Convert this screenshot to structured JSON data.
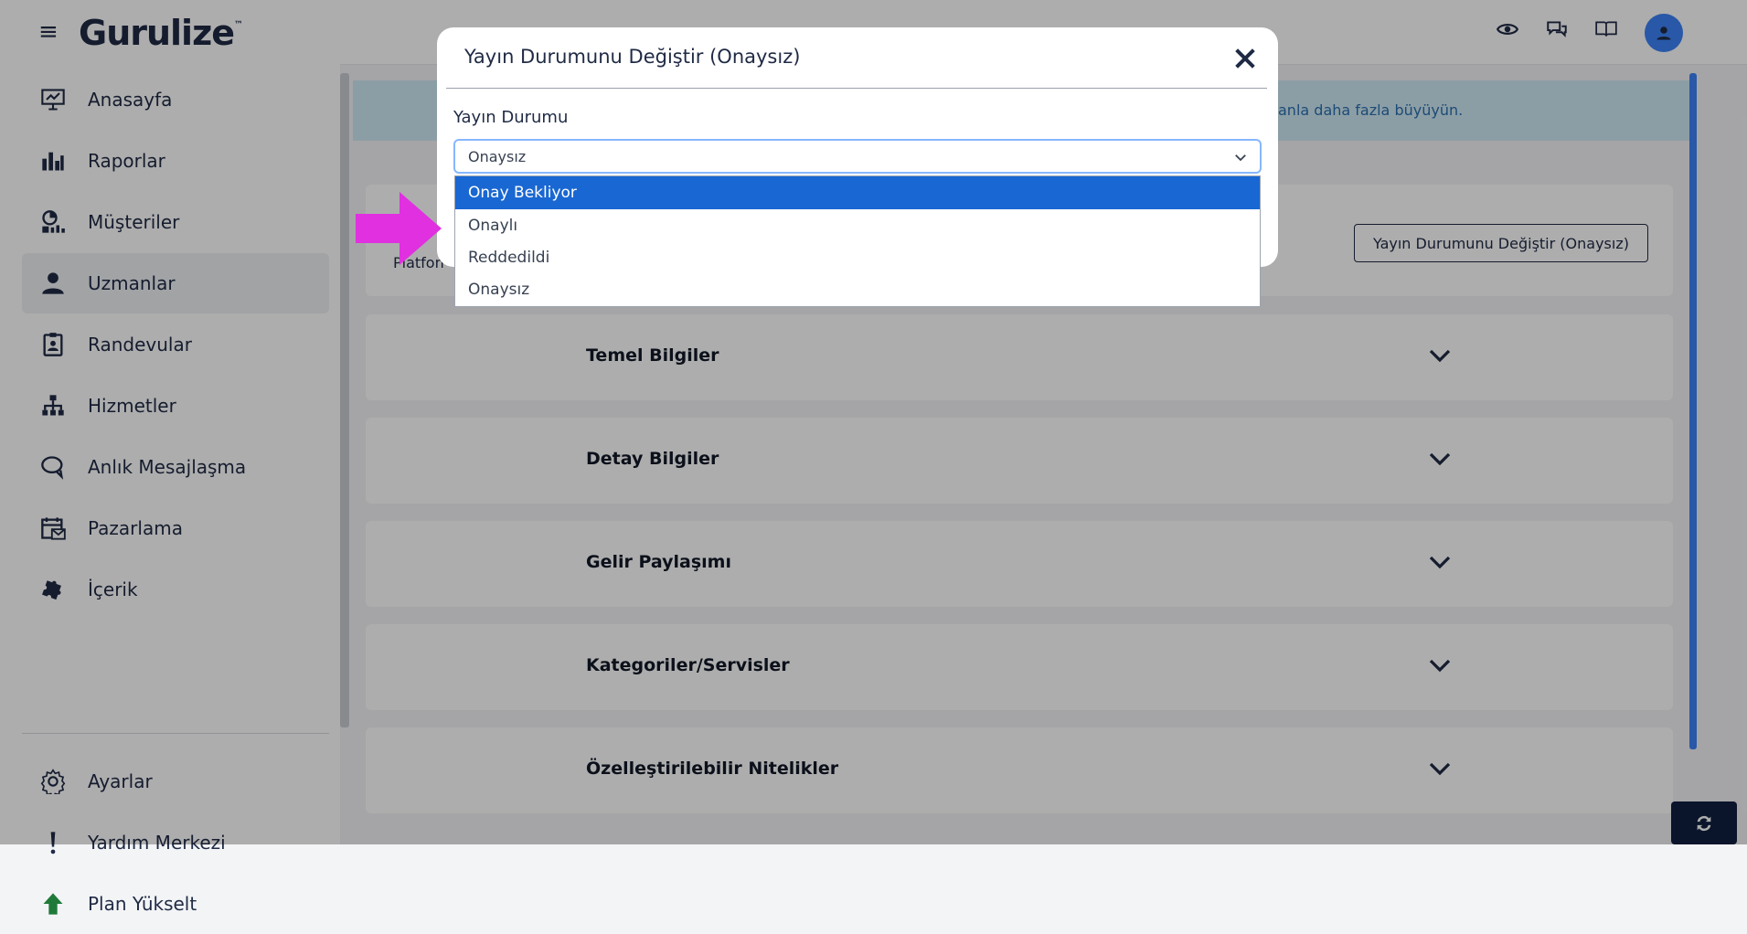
{
  "app": {
    "logo": "Gurulize",
    "logo_mark": "™"
  },
  "topbar": {
    "icons": [
      "eye-icon",
      "chat-icon",
      "book-icon"
    ],
    "avatar": "user-avatar"
  },
  "sidebar": {
    "items": [
      {
        "label": "Anasayfa",
        "icon": "presentation-icon"
      },
      {
        "label": "Raporlar",
        "icon": "bar-chart-icon"
      },
      {
        "label": "Müşteriler",
        "icon": "customer-chart-icon"
      },
      {
        "label": "Uzmanlar",
        "icon": "user-icon",
        "active": true
      },
      {
        "label": "Randevular",
        "icon": "badge-icon"
      },
      {
        "label": "Hizmetler",
        "icon": "sitemap-icon"
      },
      {
        "label": "Anlık Mesajlaşma",
        "icon": "chat-bubble-icon"
      },
      {
        "label": "Pazarlama",
        "icon": "calendar-mail-icon"
      },
      {
        "label": "İçerik",
        "icon": "puzzle-icon"
      }
    ],
    "bottom_items": [
      {
        "label": "Ayarlar",
        "icon": "gear-icon"
      },
      {
        "label": "Yardım Merkezi",
        "icon": "exclamation-icon"
      },
      {
        "label": "Plan Yükselt",
        "icon": "upgrade-icon"
      }
    ]
  },
  "main": {
    "banner_text": "anla daha fazla büyüyün.",
    "platform_text": "Platfon",
    "status_button": "Yayın Durumunu Değiştir (Onaysız)",
    "sections": [
      {
        "title": "Temel Bilgiler"
      },
      {
        "title": "Detay Bilgiler"
      },
      {
        "title": "Gelir Paylaşımı"
      },
      {
        "title": "Kategoriler/Servisler"
      },
      {
        "title": "Özelleştirilebilir Nitelikler"
      }
    ]
  },
  "modal": {
    "title": "Yayın Durumunu Değiştir (Onaysız)",
    "field_label": "Yayın Durumu",
    "select_value": "Onaysız",
    "options": [
      "Onay Bekliyor",
      "Onaylı",
      "Reddedildi",
      "Onaysız"
    ],
    "highlighted_option": "Onay Bekliyor"
  },
  "colors": {
    "accent": "#1967d2",
    "brand_dark": "#1f2a44",
    "banner_bg": "#cfe9f3",
    "annotation_arrow": "#e030e0"
  }
}
